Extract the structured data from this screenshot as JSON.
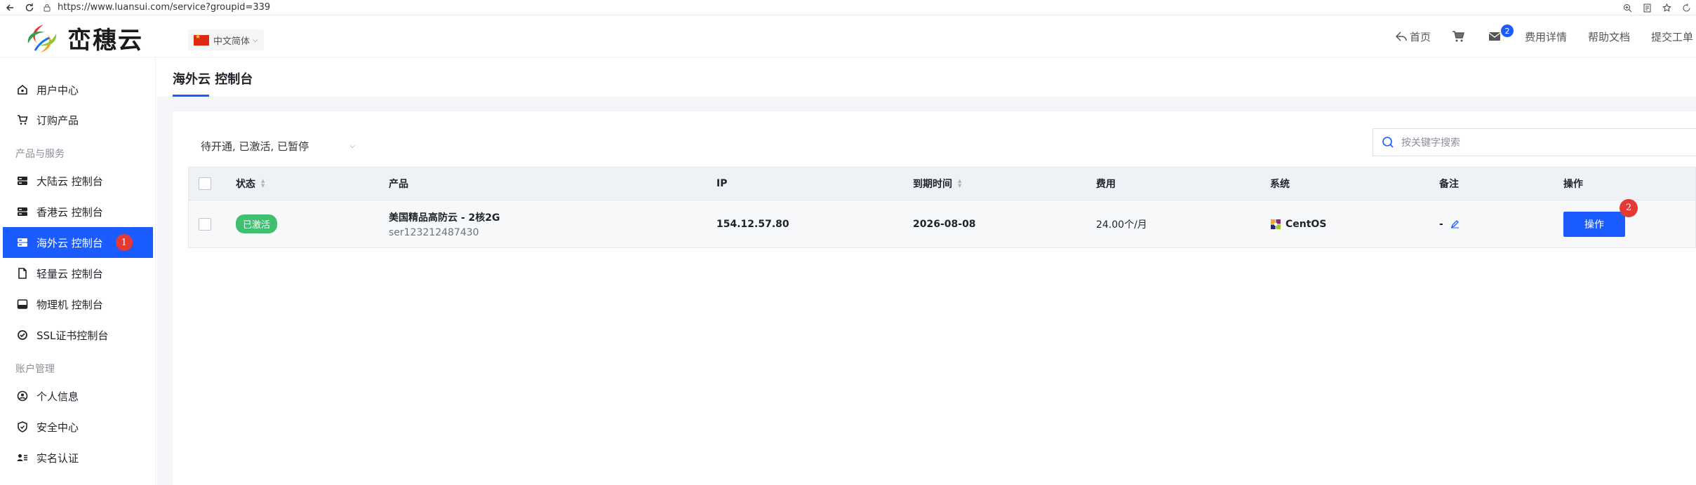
{
  "browser": {
    "url": "https://www.luansui.com/service?groupid=339"
  },
  "header": {
    "brand": "峦穗云",
    "language": "中文简体",
    "nav": {
      "home": "首页",
      "mail_count": "2",
      "billing": "费用详情",
      "help": "帮助文档",
      "ticket": "提交工单"
    }
  },
  "sidebar": {
    "user_center": "用户中心",
    "order": "订购产品",
    "group_products": "产品与服务",
    "mainland": "大陆云 控制台",
    "hongkong": "香港云 控制台",
    "overseas": "海外云 控制台",
    "overseas_badge": "1",
    "lightweight": "轻量云 控制台",
    "physical": "物理机 控制台",
    "ssl": "SSL证书控制台",
    "group_account": "账户管理",
    "profile": "个人信息",
    "security": "安全中心",
    "realname": "实名认证"
  },
  "page": {
    "title": "海外云 控制台",
    "filter": "待开通, 已激活, 已暂停",
    "search_placeholder": "按关键字搜索"
  },
  "table": {
    "headers": {
      "status": "状态",
      "product": "产品",
      "ip": "IP",
      "expiry": "到期时间",
      "fee": "费用",
      "system": "系统",
      "remark": "备注",
      "action": "操作"
    },
    "rows": [
      {
        "status": "已激活",
        "product_name": "美国精品高防云 - 2核2G",
        "product_id": "ser123212487430",
        "ip": "154.12.57.80",
        "expiry": "2026-08-08",
        "fee": "24.00个/月",
        "system": "CentOS",
        "remark": "-",
        "action": "操作",
        "action_badge": "2"
      }
    ]
  },
  "colors": {
    "accent": "#1a5cff",
    "active_status": "#3fbf6f",
    "badge": "#e53935"
  }
}
